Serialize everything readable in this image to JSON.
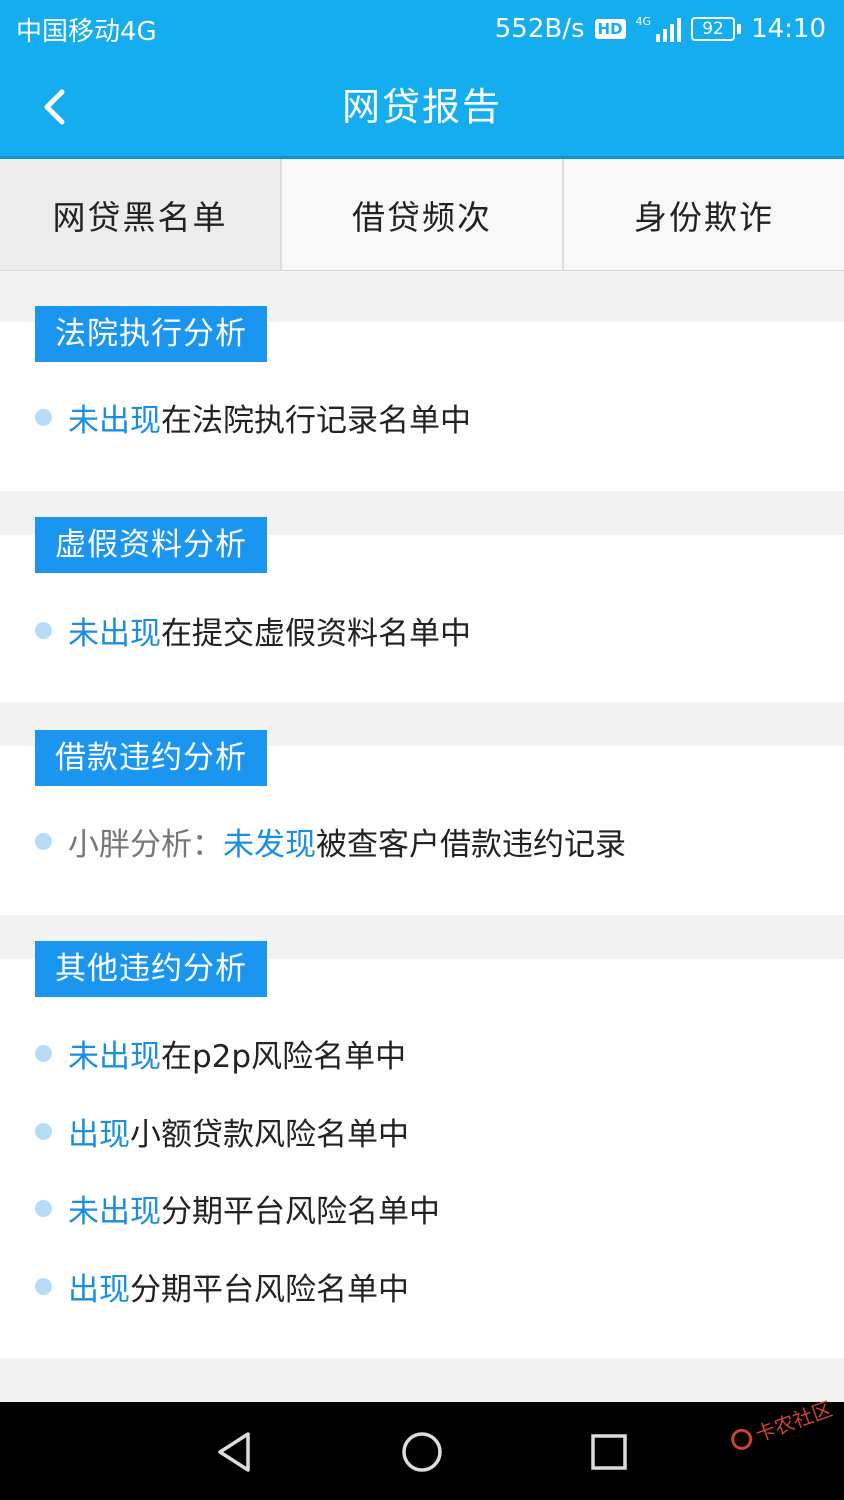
{
  "status_bar": {
    "carrier": "中国移动4G",
    "speed": "552B/s",
    "hd": "HD",
    "network": "4G",
    "battery": "92",
    "time": "14:10"
  },
  "header": {
    "title": "网贷报告",
    "back_icon": "chevron-left-icon"
  },
  "tabs": [
    {
      "label": "网贷黑名单",
      "active": true
    },
    {
      "label": "借贷频次",
      "active": false
    },
    {
      "label": "身份欺诈",
      "active": false
    }
  ],
  "sections": [
    {
      "tag": "法院执行分析",
      "items": [
        {
          "prefix": "",
          "highlight": "未出现",
          "text": "在法院执行记录名单中"
        }
      ]
    },
    {
      "tag": "虚假资料分析",
      "items": [
        {
          "prefix": "",
          "highlight": "未出现",
          "text": "在提交虚假资料名单中"
        }
      ]
    },
    {
      "tag": "借款违约分析",
      "items": [
        {
          "prefix": "小胖分析：",
          "highlight": "未发现",
          "text": "被查客户借款违约记录"
        }
      ]
    },
    {
      "tag": "其他违约分析",
      "items": [
        {
          "prefix": "",
          "highlight": "未出现",
          "text": "在p2p风险名单中"
        },
        {
          "prefix": "",
          "highlight": "出现",
          "text": "小额贷款风险名单中"
        },
        {
          "prefix": "",
          "highlight": "未出现",
          "text": "分期平台风险名单中"
        },
        {
          "prefix": "",
          "highlight": "出现",
          "text": "分期平台风险名单中"
        }
      ]
    }
  ],
  "nav": {
    "back": "triangle-back-icon",
    "home": "circle-home-icon",
    "recents": "square-recents-icon"
  },
  "watermark": "卡农社区",
  "colors": {
    "primary": "#14aef0",
    "tag": "#1a96f0",
    "highlight": "#1a8fe0",
    "bullet": "#b7dcf8"
  }
}
